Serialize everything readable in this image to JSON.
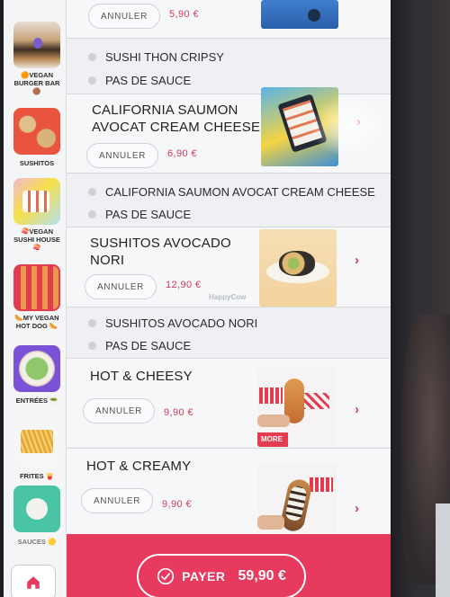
{
  "sidebar": {
    "categories": [
      {
        "label": "🟠VEGAN BURGER BAR 🟤"
      },
      {
        "label": "SUSHITOS"
      },
      {
        "label": "🍣VEGAN SUSHI HOUSE 🍣"
      },
      {
        "label": "🌭MY VEGAN HOT DOG 🌭"
      },
      {
        "label": "ENTRÉES 🥗"
      },
      {
        "label": "FRITES 🍟"
      },
      {
        "label": "SAUCES 🟡"
      }
    ]
  },
  "cart": {
    "items": [
      {
        "name": "",
        "cancel_label": "ANNULER",
        "price": "5,90 €"
      },
      {
        "name": "CALIFORNIA SAUMON AVOCAT CREAM CHEESE",
        "cancel_label": "ANNULER",
        "price": "6,90 €"
      },
      {
        "name": "SUSHITOS AVOCADO NORI",
        "cancel_label": "ANNULER",
        "price": "12,90 €"
      },
      {
        "name": "HOT & CHEESY",
        "cancel_label": "ANNULER",
        "price": "9,90 €"
      },
      {
        "name": "HOT & CREAMY",
        "cancel_label": "ANNULER",
        "price": "9,90 €"
      }
    ],
    "options": [
      {
        "text": "SUSHI THON CRIPSY"
      },
      {
        "text": "PAS DE SAUCE"
      },
      {
        "text": "CALIFORNIA SAUMON AVOCAT CREAM CHEESE"
      },
      {
        "text": "PAS DE SAUCE"
      },
      {
        "text": "SUSHITOS AVOCADO NORI"
      },
      {
        "text": "PAS DE SAUCE"
      }
    ],
    "item_names_split": {
      "california_line1": "CALIFORNIA SAUMON",
      "california_line2": "AVOCAT CREAM CHEESE",
      "sushitos_line1": "SUSHITOS AVOCADO",
      "sushitos_line2": "NORI"
    },
    "photo_badge": "MORE",
    "watermark": "HappyCow"
  },
  "footer": {
    "pay_label": "PAYER",
    "total": "59,90 €"
  },
  "colors": {
    "accent": "#e8395e",
    "price": "#d23a57"
  },
  "icons": {
    "pay": "check-circle-icon",
    "chevron": "chevron-right-icon",
    "home": "home-icon"
  }
}
